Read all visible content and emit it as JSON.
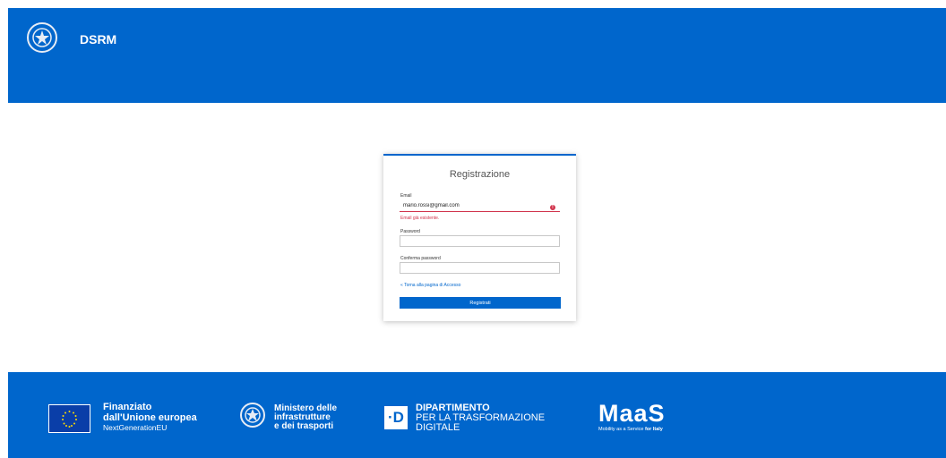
{
  "header": {
    "emblem": "italian-republic-emblem",
    "title": "DSRM"
  },
  "form": {
    "title": "Registrazione",
    "email": {
      "label": "Email",
      "value": "mario.rossi@gmail.com",
      "error": "Email già esistente."
    },
    "password": {
      "label": "Password",
      "value": ""
    },
    "confirm_password": {
      "label": "Conferma password",
      "value": ""
    },
    "back_link": "« Torna alla pagina di Accesso",
    "submit_label": "Registrati"
  },
  "footer": {
    "eu": {
      "line1": "Finanziato",
      "line2": "dall'Unione europea",
      "line3": "NextGenerationEU"
    },
    "ministry": {
      "line1": "Ministero delle",
      "line2": "infrastrutture",
      "line3": "e dei trasporti"
    },
    "department": {
      "badge": "·D",
      "line1": "DIPARTIMENTO",
      "line2": "PER LA TRASFORMAZIONE",
      "line3": "DIGITALE"
    },
    "maas": {
      "logo": "MaaS",
      "sub_prefix": "Mobility as a Service ",
      "sub_bold": "for Italy"
    }
  },
  "colors": {
    "primary": "#0066cc",
    "error": "#d1344c"
  }
}
